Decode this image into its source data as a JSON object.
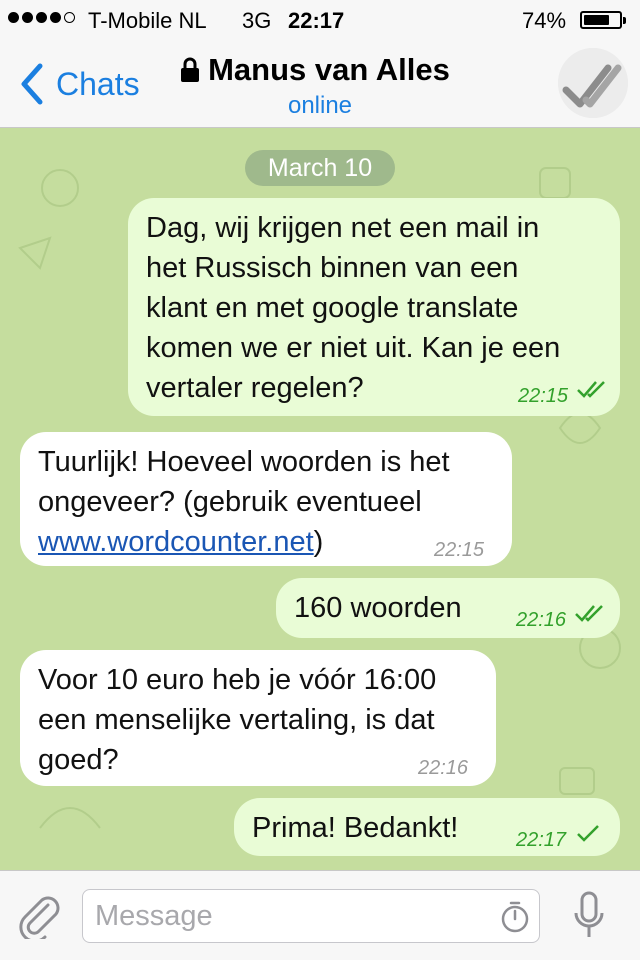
{
  "status_bar": {
    "carrier": "T-Mobile NL",
    "network": "3G",
    "time": "22:17",
    "battery_percent": "74%",
    "battery_level": 0.74,
    "signal_bars": 4,
    "signal_max": 5
  },
  "header": {
    "back_label": "Chats",
    "title": "Manus van Alles",
    "status": "online",
    "icons": [
      "chevron-left-icon",
      "lock-icon",
      "avatar"
    ]
  },
  "chat": {
    "date_separator": "March 10",
    "messages": [
      {
        "direction": "outgoing",
        "lines": [
          "Dag, wij krijgen net een mail in",
          "het Russisch binnen van een",
          "klant en met google translate",
          "komen we er niet uit. Kan je een",
          "vertaler regelen?"
        ],
        "time": "22:15",
        "status": "read"
      },
      {
        "direction": "incoming",
        "lines": [
          "Tuurlijk! Hoeveel woorden is het",
          "ongeveer? (gebruik eventueel"
        ],
        "link": "www.wordcounter.net",
        "link_suffix": ")",
        "time": "22:15"
      },
      {
        "direction": "outgoing",
        "lines": [
          "160 woorden"
        ],
        "time": "22:16",
        "status": "read"
      },
      {
        "direction": "incoming",
        "lines": [
          "Voor 10 euro heb je vóór 16:00",
          "een menselijke vertaling, is dat",
          "goed?"
        ],
        "time": "22:16"
      },
      {
        "direction": "outgoing",
        "lines": [
          "Prima! Bedankt!"
        ],
        "time": "22:17",
        "status": "delivered"
      }
    ]
  },
  "input_bar": {
    "placeholder": "Message",
    "icons": [
      "paperclip-icon",
      "timer-icon",
      "microphone-icon"
    ]
  },
  "colors": {
    "accent": "#1b7fe0",
    "chat_background": "#c5dd9e",
    "outgoing_bubble": "#e9fcd6",
    "incoming_bubble": "#ffffff",
    "check_green": "#33a12c"
  }
}
